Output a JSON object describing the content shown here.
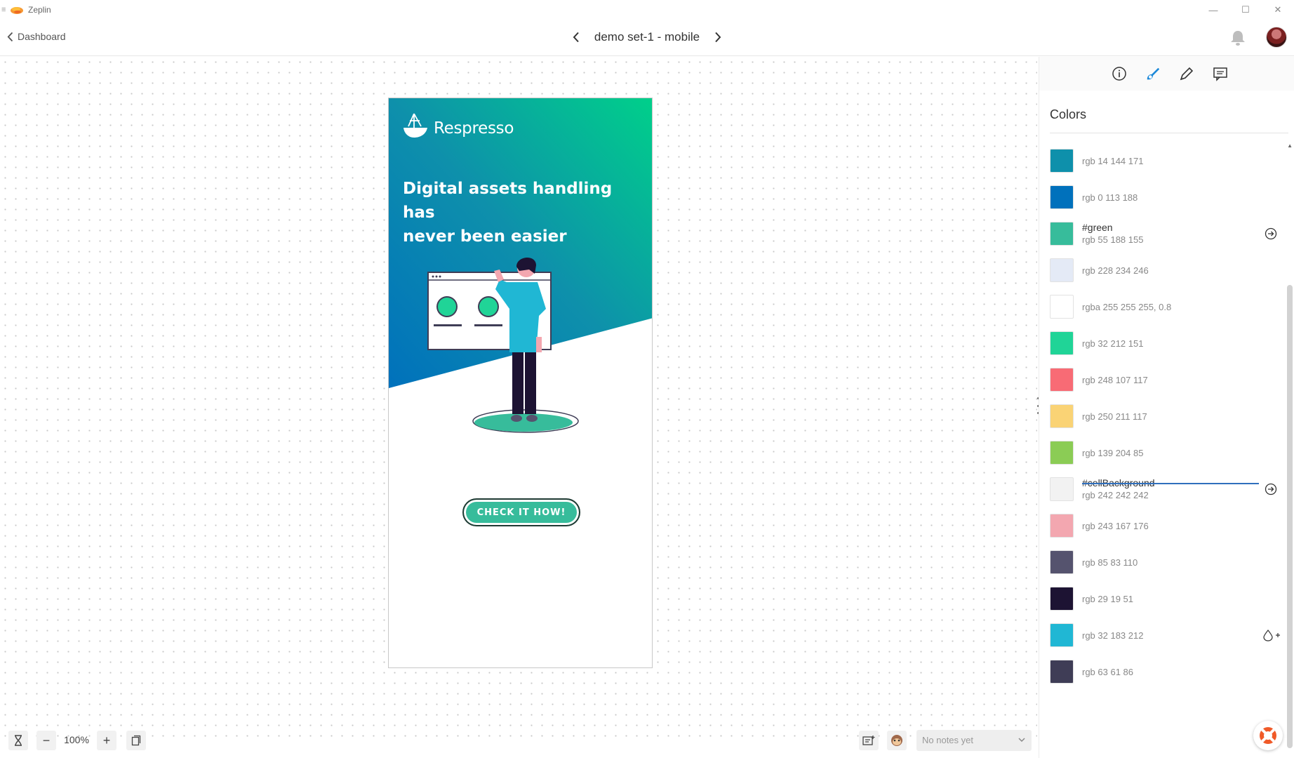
{
  "window": {
    "app_name": "Zeplin",
    "controls": {
      "minimize": "—",
      "maximize": "☐",
      "close": "✕"
    }
  },
  "header": {
    "back_label": "Dashboard",
    "screen_title": "demo set-1 - mobile"
  },
  "artboard": {
    "brand": "Respresso",
    "headline_line1": "Digital assets handling has",
    "headline_line2": "never been easier",
    "cta_label": "CHECK IT HOW!",
    "colors": {
      "teal": "#0e90ab",
      "green": "#00d08a",
      "blue": "#0071bc",
      "button": "#37bc9b"
    }
  },
  "toolbar": {
    "zoom": "100%",
    "zoom_out": "−",
    "zoom_in": "+",
    "notes_placeholder": "No notes yet"
  },
  "sidebar": {
    "tabs": [
      "info-icon",
      "styleguide-icon",
      "pen-icon",
      "comments-icon"
    ],
    "active_tab": "styleguide-icon",
    "heading": "Colors",
    "colors": [
      {
        "name": "",
        "value": "rgb 14 144 171",
        "hex": "#0e90ab"
      },
      {
        "name": "",
        "value": "rgb 0 113 188",
        "hex": "#0071bc"
      },
      {
        "name": "#green",
        "value": "rgb 55 188 155",
        "hex": "#37bc9b"
      },
      {
        "name": "",
        "value": "rgb 228 234 246",
        "hex": "#e4eaf6"
      },
      {
        "name": "",
        "value": "rgba 255 255 255, 0.8",
        "hex": "#ffffff"
      },
      {
        "name": "",
        "value": "rgb 32 212 151",
        "hex": "#20d497"
      },
      {
        "name": "",
        "value": "rgb 248 107 117",
        "hex": "#f86b75"
      },
      {
        "name": "",
        "value": "rgb 250 211 117",
        "hex": "#fad375"
      },
      {
        "name": "",
        "value": "rgb 139 204 85",
        "hex": "#8bcc55"
      },
      {
        "name": "#cellBackground",
        "value": "rgb 242 242 242",
        "hex": "#f2f2f2"
      },
      {
        "name": "",
        "value": "rgb 243 167 176",
        "hex": "#f3a7b0"
      },
      {
        "name": "",
        "value": "rgb 85 83 110",
        "hex": "#55536e"
      },
      {
        "name": "",
        "value": "rgb 29 19 51",
        "hex": "#1d1333"
      },
      {
        "name": "",
        "value": "rgb 32 183 212",
        "hex": "#20b7d4"
      },
      {
        "name": "",
        "value": "rgb 63 61 86",
        "hex": "#3f3d56"
      }
    ]
  }
}
